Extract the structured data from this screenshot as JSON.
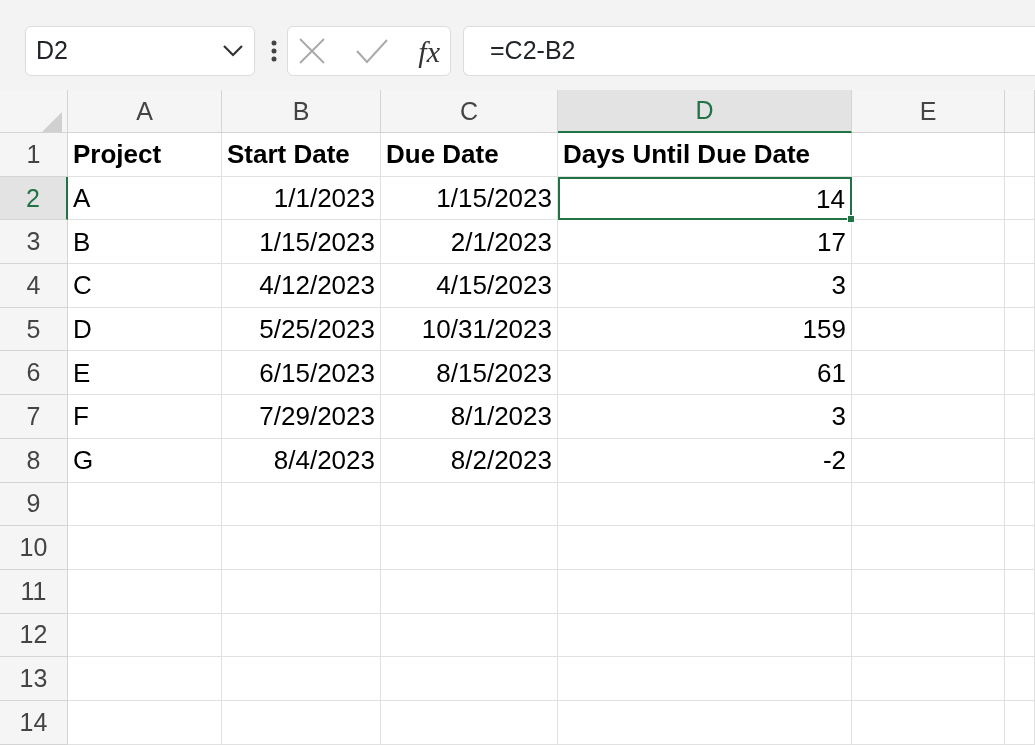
{
  "formula_bar": {
    "name_box": "D2",
    "function_label": "fx",
    "formula": "=C2-B2"
  },
  "columns": [
    {
      "label": "A",
      "selected": false
    },
    {
      "label": "B",
      "selected": false
    },
    {
      "label": "C",
      "selected": false
    },
    {
      "label": "D",
      "selected": true
    },
    {
      "label": "E",
      "selected": false
    }
  ],
  "rows": [
    {
      "number": "1",
      "selected": false,
      "kind": "header",
      "cells": [
        {
          "value": "Project",
          "kind": "text",
          "selected": false
        },
        {
          "value": "Start Date",
          "kind": "text",
          "selected": false
        },
        {
          "value": "Due Date",
          "kind": "text",
          "selected": false
        },
        {
          "value": "Days Until Due Date",
          "kind": "text",
          "selected": false
        }
      ]
    },
    {
      "number": "2",
      "selected": true,
      "kind": "data",
      "cells": [
        {
          "value": "A",
          "kind": "text",
          "selected": false
        },
        {
          "value": "1/1/2023",
          "kind": "number",
          "selected": false
        },
        {
          "value": "1/15/2023",
          "kind": "number",
          "selected": false
        },
        {
          "value": "14",
          "kind": "number",
          "selected": true
        }
      ]
    },
    {
      "number": "3",
      "selected": false,
      "kind": "data",
      "cells": [
        {
          "value": "B",
          "kind": "text",
          "selected": false
        },
        {
          "value": "1/15/2023",
          "kind": "number",
          "selected": false
        },
        {
          "value": "2/1/2023",
          "kind": "number",
          "selected": false
        },
        {
          "value": "17",
          "kind": "number",
          "selected": false
        }
      ]
    },
    {
      "number": "4",
      "selected": false,
      "kind": "data",
      "cells": [
        {
          "value": "C",
          "kind": "text",
          "selected": false
        },
        {
          "value": "4/12/2023",
          "kind": "number",
          "selected": false
        },
        {
          "value": "4/15/2023",
          "kind": "number",
          "selected": false
        },
        {
          "value": "3",
          "kind": "number",
          "selected": false
        }
      ]
    },
    {
      "number": "5",
      "selected": false,
      "kind": "data",
      "cells": [
        {
          "value": "D",
          "kind": "text",
          "selected": false
        },
        {
          "value": "5/25/2023",
          "kind": "number",
          "selected": false
        },
        {
          "value": "10/31/2023",
          "kind": "number",
          "selected": false
        },
        {
          "value": "159",
          "kind": "number",
          "selected": false
        }
      ]
    },
    {
      "number": "6",
      "selected": false,
      "kind": "data",
      "cells": [
        {
          "value": "E",
          "kind": "text",
          "selected": false
        },
        {
          "value": "6/15/2023",
          "kind": "number",
          "selected": false
        },
        {
          "value": "8/15/2023",
          "kind": "number",
          "selected": false
        },
        {
          "value": "61",
          "kind": "number",
          "selected": false
        }
      ]
    },
    {
      "number": "7",
      "selected": false,
      "kind": "data",
      "cells": [
        {
          "value": "F",
          "kind": "text",
          "selected": false
        },
        {
          "value": "7/29/2023",
          "kind": "number",
          "selected": false
        },
        {
          "value": "8/1/2023",
          "kind": "number",
          "selected": false
        },
        {
          "value": "3",
          "kind": "number",
          "selected": false
        }
      ]
    },
    {
      "number": "8",
      "selected": false,
      "kind": "data",
      "cells": [
        {
          "value": "G",
          "kind": "text",
          "selected": false
        },
        {
          "value": "8/4/2023",
          "kind": "number",
          "selected": false
        },
        {
          "value": "8/2/2023",
          "kind": "number",
          "selected": false
        },
        {
          "value": "-2",
          "kind": "number",
          "selected": false
        }
      ]
    },
    {
      "number": "9",
      "selected": false
    },
    {
      "number": "10",
      "selected": false
    },
    {
      "number": "11",
      "selected": false
    },
    {
      "number": "12",
      "selected": false
    },
    {
      "number": "13",
      "selected": false
    },
    {
      "number": "14",
      "selected": false
    }
  ]
}
